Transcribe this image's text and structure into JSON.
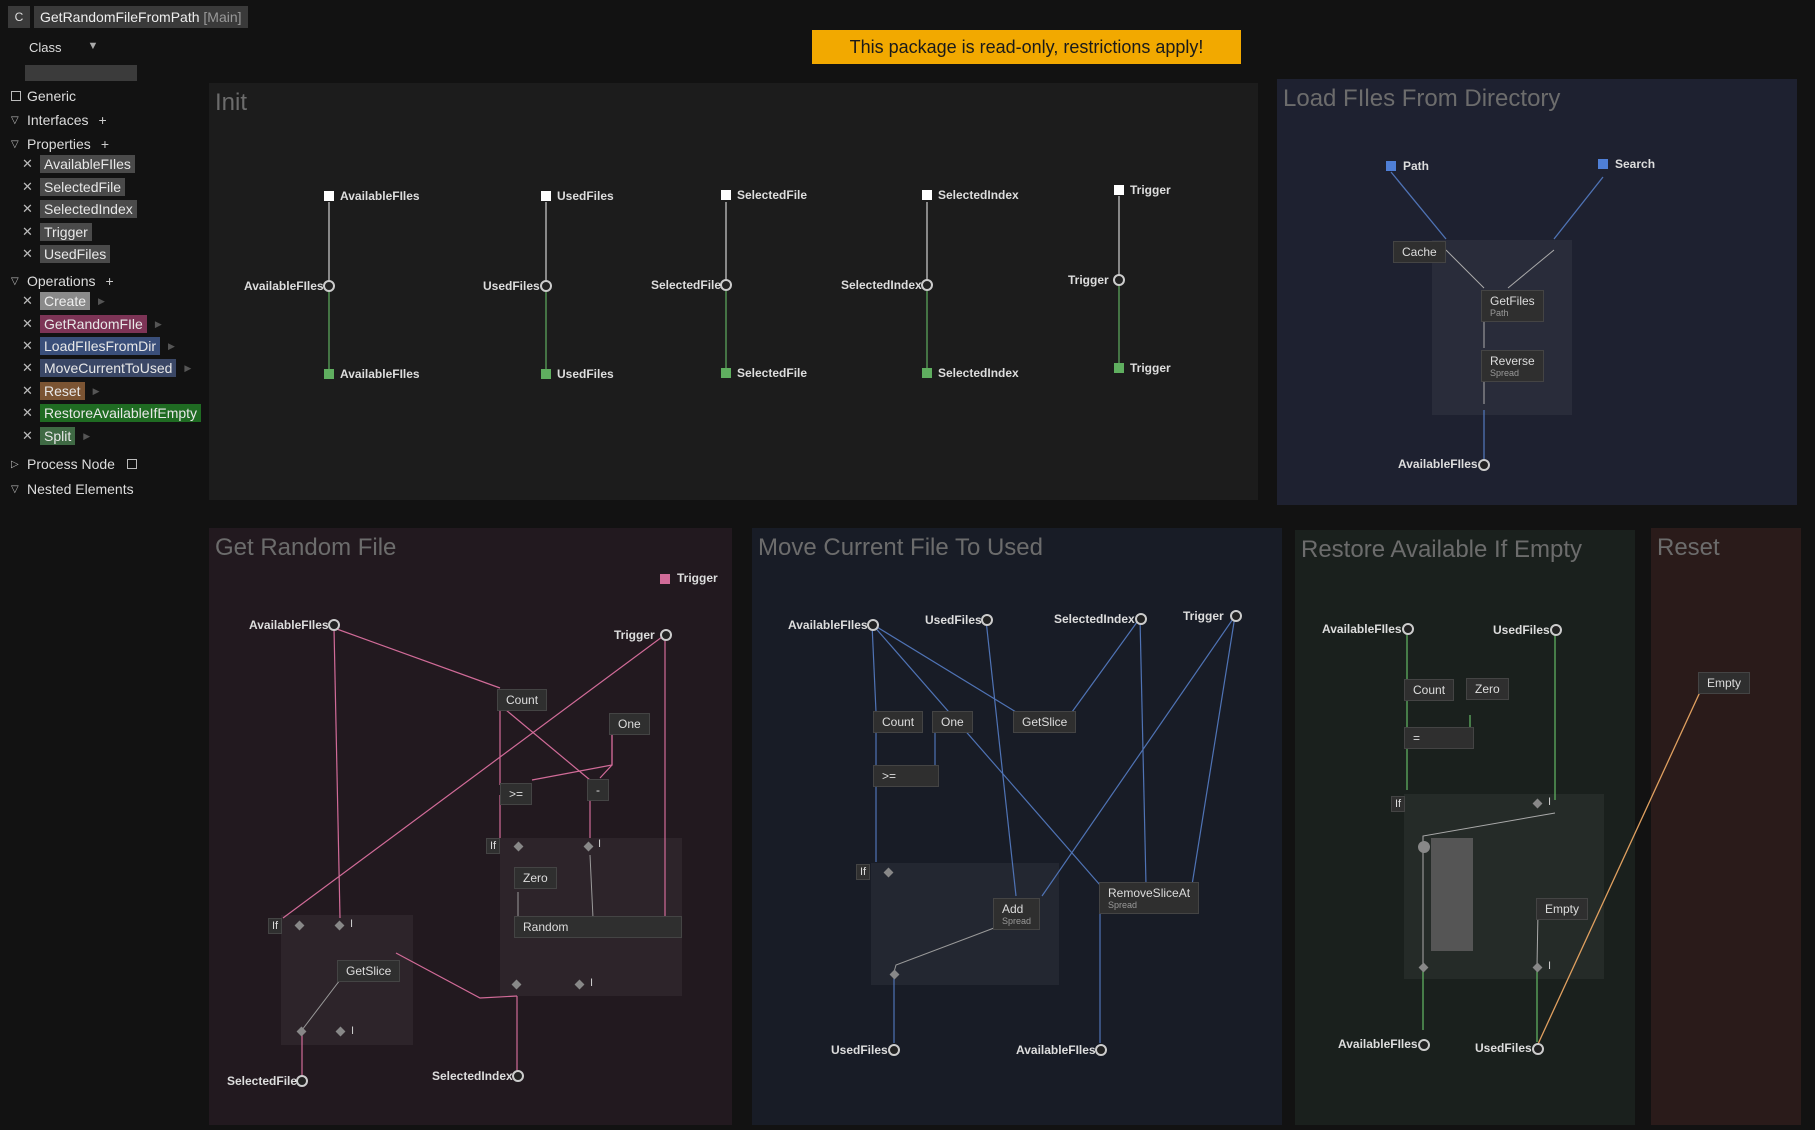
{
  "header": {
    "badge": "C",
    "title": "GetRandomFileFromPath",
    "context": "[Main]"
  },
  "warning": "This package is read-only, restrictions apply!",
  "sidebar": {
    "class_label": "Class",
    "generic": "Generic",
    "interfaces": "Interfaces",
    "properties_label": "Properties",
    "properties": [
      "AvailableFIles",
      "SelectedFile",
      "SelectedIndex",
      "Trigger",
      "UsedFiles"
    ],
    "operations_label": "Operations",
    "operations": [
      "Create",
      "GetRandomFIle",
      "LoadFIlesFromDir",
      "MoveCurrentToUsed",
      "Reset",
      "RestoreAvailableIfEmpty",
      "Split"
    ],
    "process_node": "Process Node",
    "nested": "Nested Elements"
  },
  "regions": {
    "init": "Init",
    "load": "Load FIles From Directory",
    "random": "Get Random File",
    "move": "Move Current File To Used",
    "restore": "Restore Available If Empty",
    "reset": "Reset"
  },
  "init": {
    "pads": [
      "AvailableFIles",
      "UsedFiles",
      "SelectedFile",
      "SelectedIndex",
      "Trigger"
    ],
    "pads_mid": [
      "AvailableFIles",
      "UsedFiles",
      "SelectedFile",
      "SelectedIndex",
      "Trigger"
    ],
    "pads_out": [
      "AvailableFIles",
      "UsedFiles",
      "SelectedFile",
      "SelectedIndex",
      "Trigger"
    ]
  },
  "load": {
    "path": "Path",
    "search": "Search",
    "cache": "Cache",
    "getfiles": "GetFiles",
    "getfiles_sub": "Path",
    "reverse": "Reverse",
    "reverse_sub": "Spread",
    "out": "AvailableFIles"
  },
  "random": {
    "trigger_top": "Trigger",
    "available": "AvailableFIles",
    "trigger": "Trigger",
    "count": "Count",
    "one": "One",
    "ge": ">=",
    "minus": "-",
    "if1": "If",
    "if2": "If",
    "zero": "Zero",
    "random": "Random",
    "getslice": "GetSlice",
    "selected_file": "SelectedFile",
    "selected_index": "SelectedIndex",
    "bar": "I"
  },
  "move": {
    "available": "AvailableFIles",
    "used": "UsedFiles",
    "selected_index": "SelectedIndex",
    "trigger": "Trigger",
    "count": "Count",
    "one": "One",
    "getslice": "GetSlice",
    "ge": ">=",
    "if": "If",
    "add": "Add",
    "add_sub": "Spread",
    "remove": "RemoveSliceAt",
    "remove_sub": "Spread",
    "out_used": "UsedFiles",
    "out_available": "AvailableFIles"
  },
  "restore": {
    "available": "AvailableFIles",
    "used": "UsedFiles",
    "count": "Count",
    "zero": "Zero",
    "eq": "=",
    "if": "If",
    "zero_val": "0",
    "empty": "Empty",
    "out_available": "AvailableFIles",
    "out_used": "UsedFiles",
    "bar": "I"
  },
  "reset": {
    "empty": "Empty"
  },
  "colors": {
    "pink": "#d16b98",
    "blue": "#4f73b5",
    "green": "#5fae5f",
    "orange": "#e0a060",
    "warning": "#f2a900"
  }
}
